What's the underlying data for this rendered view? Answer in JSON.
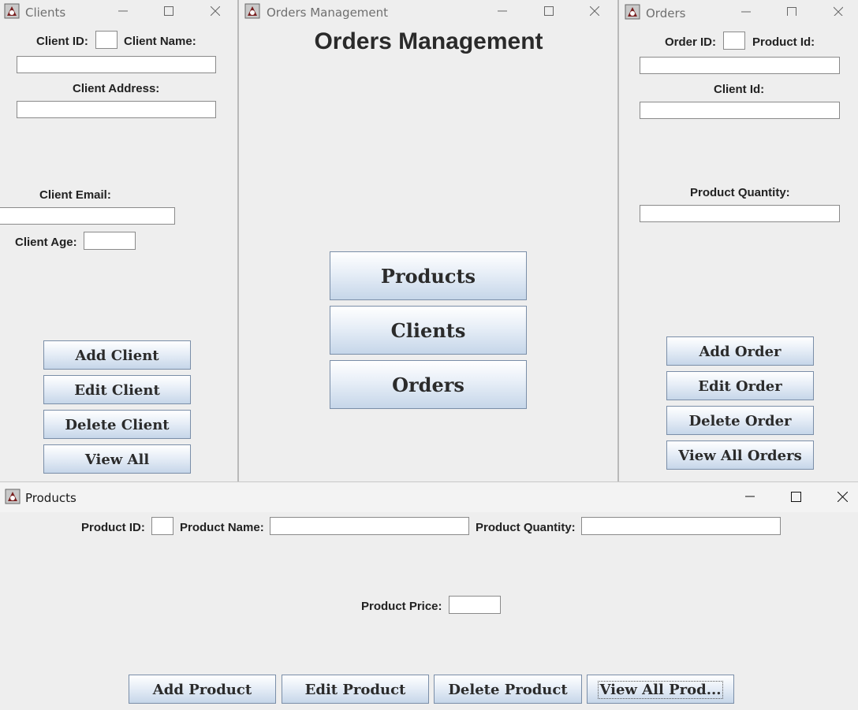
{
  "clients_window": {
    "title": "Clients",
    "client_id_label": "Client ID:",
    "client_name_label": "Client Name:",
    "client_address_label": "Client Address:",
    "client_email_label": "Client Email:",
    "client_age_label": "Client Age:",
    "buttons": {
      "add": "Add Client",
      "edit": "Edit Client",
      "delete": "Delete Client",
      "view_all": "View All"
    }
  },
  "main_window": {
    "title": "Orders Management",
    "heading": "Orders Management",
    "buttons": {
      "products": "Products",
      "clients": "Clients",
      "orders": "Orders"
    }
  },
  "orders_window": {
    "title": "Orders",
    "order_id_label": "Order ID:",
    "product_id_label": "Product Id:",
    "client_id_label": "Client Id:",
    "product_quantity_label": "Product Quantity:",
    "buttons": {
      "add": "Add Order",
      "edit": "Edit Order",
      "delete": "Delete Order",
      "view_all": "View All Orders"
    }
  },
  "products_window": {
    "title": "Products",
    "product_id_label": "Product ID:",
    "product_name_label": "Product Name:",
    "product_quantity_label": "Product Quantity:",
    "product_price_label": "Product Price:",
    "buttons": {
      "add": "Add Product",
      "edit": "Edit Product",
      "delete": "Delete Product",
      "view_all": "View All Prod..."
    }
  },
  "icons": {
    "app": "java-app-icon",
    "minimize": "minimize-icon",
    "maximize": "maximize-icon",
    "close": "close-icon"
  },
  "colors": {
    "window_bg": "#eeeeee",
    "button_gradient_bottom": "#c6d6e9",
    "button_border": "#7a8ea8"
  }
}
